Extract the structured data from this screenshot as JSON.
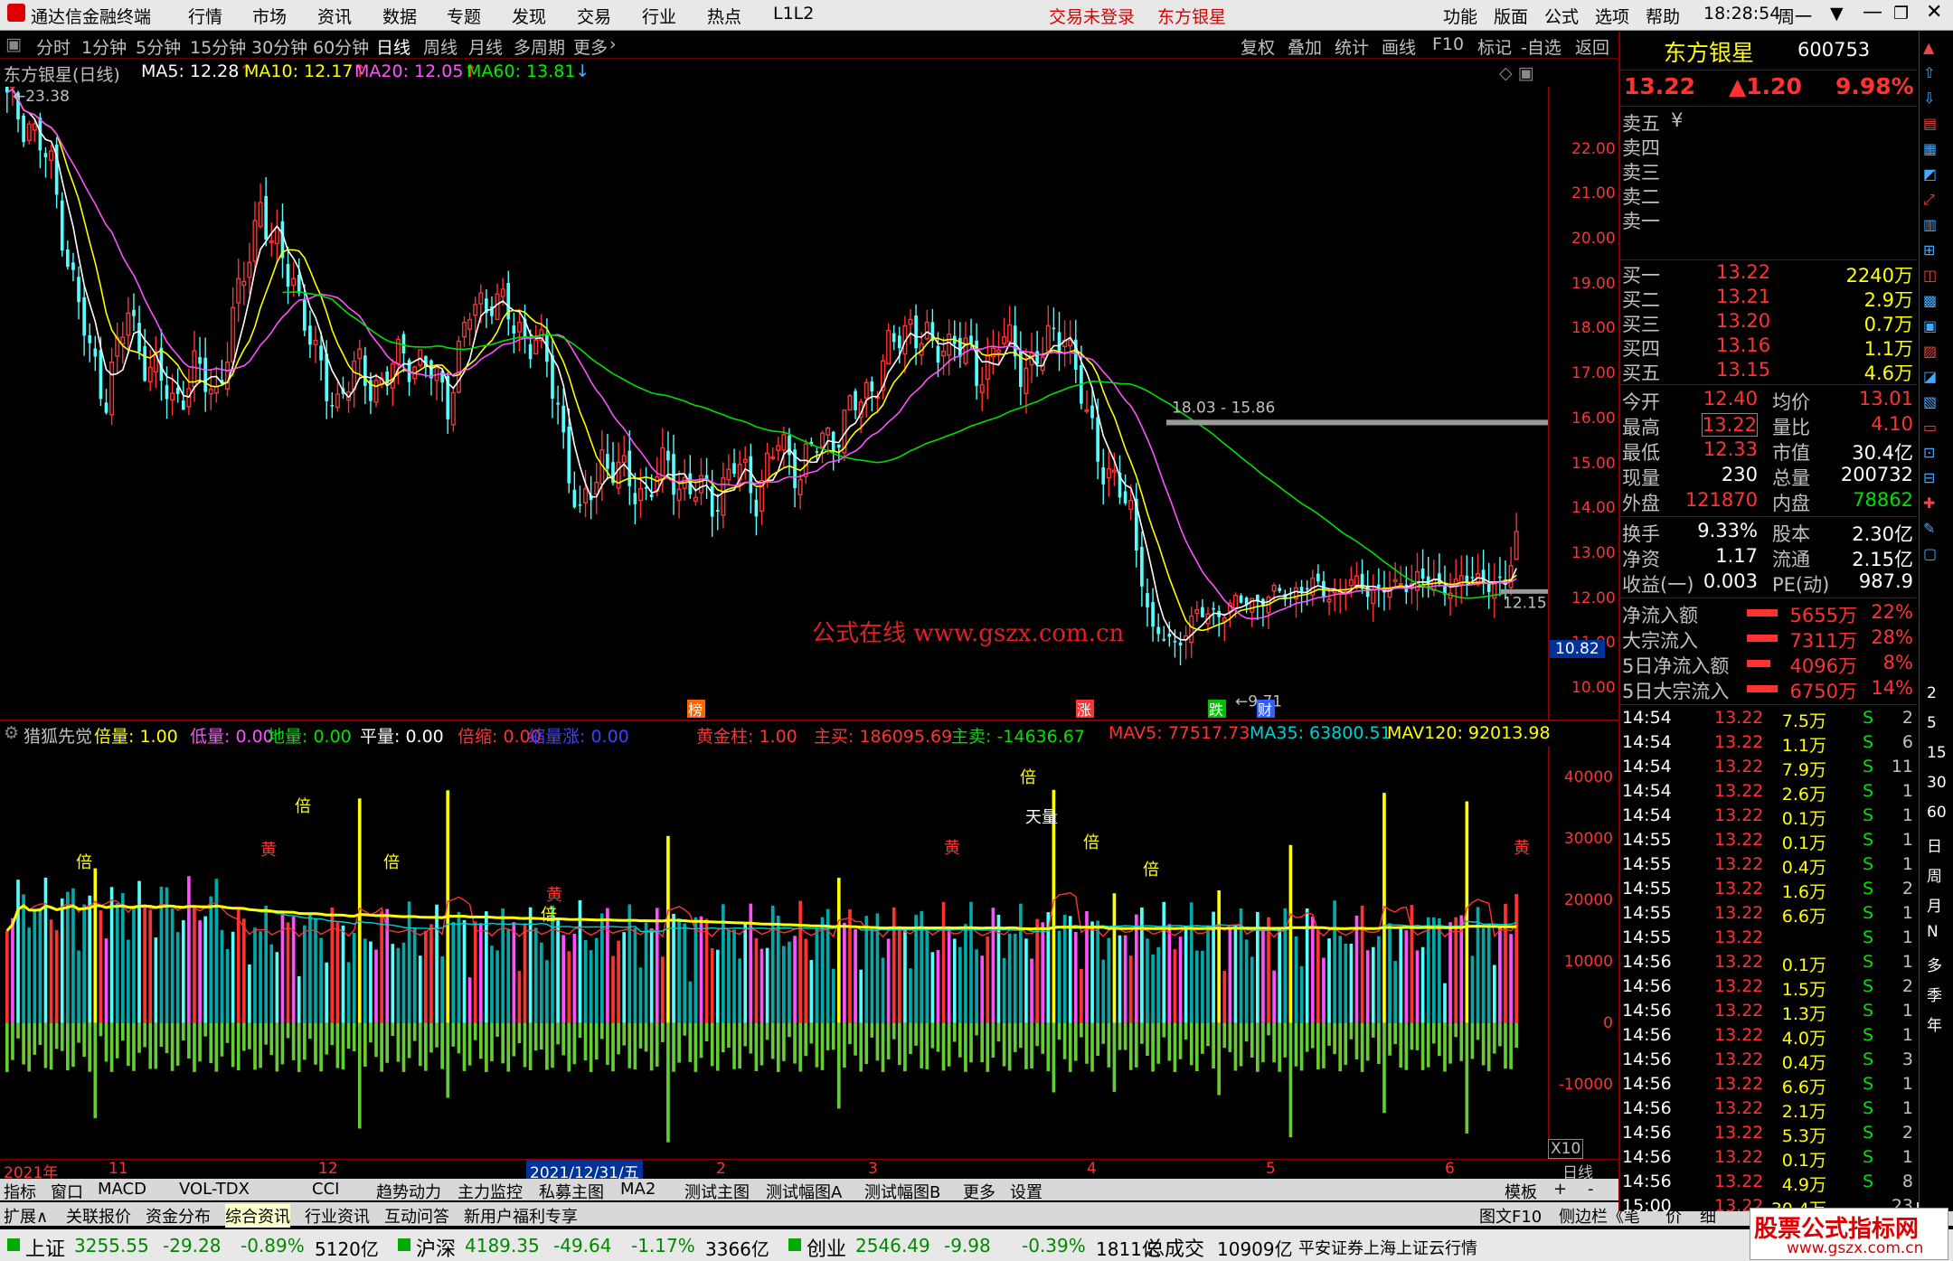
{
  "topbar": {
    "app_title": "通达信金融终端",
    "menu": [
      "行情",
      "市场",
      "资讯",
      "数据",
      "专题",
      "发现",
      "交易",
      "行业",
      "热点",
      "L1L2"
    ],
    "trade_status": "交易未登录",
    "stock_title": "东方银星",
    "right_menu": [
      "功能",
      "版面",
      "公式",
      "选项",
      "帮助"
    ],
    "time": "18:28:54",
    "weekday": "周一"
  },
  "periods": [
    "分时",
    "1分钟",
    "5分钟",
    "15分钟",
    "30分钟",
    "60分钟",
    "日线",
    "周线",
    "月线",
    "多周期",
    "更多"
  ],
  "toolbar": [
    "复权",
    "叠加",
    "统计",
    "画线",
    "F10",
    "标记",
    "-自选",
    "返回"
  ],
  "chart": {
    "title": "东方银星(日线)",
    "ma": [
      {
        "label": "MA5: 12.28",
        "color": "#ffffff"
      },
      {
        "label": "MA10: 12.17",
        "color": "#ffff00"
      },
      {
        "label": "MA20: 12.05",
        "color": "#ff50ff"
      },
      {
        "label": "MA60: 13.81",
        "color": "#00e000"
      }
    ],
    "high_label": "23.38",
    "low_label": "9.71",
    "line_label": "18.03 - 15.86",
    "last_label": "12.15",
    "cursor_price": "10.82",
    "watermark": "公式在线 www.gszx.com.cn",
    "markers": [
      "榜",
      "涨",
      "跌",
      "财"
    ],
    "y_ticks": [
      "22.00",
      "21.00",
      "20.00",
      "19.00",
      "18.00",
      "17.00",
      "16.00",
      "15.00",
      "14.00",
      "13.00",
      "12.00",
      "11.00",
      "10.00"
    ]
  },
  "indicator": {
    "name": "猎狐先觉",
    "fields": [
      {
        "t": "倍量: 1.00",
        "c": "#ffff00"
      },
      {
        "t": "低量: 0.00",
        "c": "#ff50ff"
      },
      {
        "t": "地量: 0.00",
        "c": "#00e000"
      },
      {
        "t": "平量: 0.00",
        "c": "#ffffff"
      },
      {
        "t": "倍缩: 0.00",
        "c": "#ff3232"
      },
      {
        "t": "缩量涨: 0.00",
        "c": "#4040ff"
      },
      {
        "t": "黄金柱: 1.00",
        "c": "#ff3232"
      },
      {
        "t": "主买: 186095.69",
        "c": "#ff3232"
      },
      {
        "t": "主卖: -14636.67",
        "c": "#00e000"
      },
      {
        "t": "MAV5: 77517.73",
        "c": "#ff3232"
      },
      {
        "t": "MA35: 63800.51",
        "c": "#00d0d0"
      },
      {
        "t": "MAV120: 92013.98",
        "c": "#ffff00"
      }
    ],
    "y_ticks": [
      "40000",
      "30000",
      "20000",
      "10000",
      "0",
      "-10000"
    ],
    "labels": [
      "倍",
      "黄",
      "天量"
    ],
    "x10": "X10"
  },
  "x_axis": [
    "2021年",
    "11",
    "12",
    "2021/12/31/五",
    "2",
    "3",
    "4",
    "5",
    "6",
    "日线"
  ],
  "quote": {
    "name": "东方银星",
    "code": "600753",
    "price": "13.22",
    "change": "▲1.20",
    "pct": "9.98%",
    "asks": [
      [
        "卖五",
        "",
        ""
      ],
      [
        "卖四",
        "",
        ""
      ],
      [
        "卖三",
        "",
        ""
      ],
      [
        "卖二",
        "",
        ""
      ],
      [
        "卖一",
        "",
        ""
      ]
    ],
    "bids": [
      [
        "买一",
        "13.22",
        "2240万"
      ],
      [
        "买二",
        "13.21",
        "2.9万"
      ],
      [
        "买三",
        "13.20",
        "0.7万"
      ],
      [
        "买四",
        "13.16",
        "1.1万"
      ],
      [
        "买五",
        "13.15",
        "4.6万"
      ]
    ],
    "stats": [
      [
        "今开",
        "12.40",
        "均价",
        "13.01"
      ],
      [
        "最高",
        "13.22",
        "量比",
        "4.10"
      ],
      [
        "最低",
        "12.33",
        "市值",
        "30.4亿"
      ],
      [
        "现量",
        "230",
        "总量",
        "200732"
      ],
      [
        "外盘",
        "121870",
        "内盘",
        "78862"
      ],
      [
        "换手",
        "9.33%",
        "股本",
        "2.30亿"
      ],
      [
        "净资",
        "1.17",
        "流通",
        "2.15亿"
      ],
      [
        "收益(一)",
        "0.003",
        "PE(动)",
        "987.9"
      ]
    ],
    "flows": [
      [
        "净流入额",
        "5655万",
        "22%"
      ],
      [
        "大宗流入",
        "7311万",
        "28%"
      ],
      [
        "5日净流入额",
        "4096万",
        "8%"
      ],
      [
        "5日大宗流入",
        "6750万",
        "14%"
      ]
    ],
    "ticks": [
      [
        "14:54",
        "13.22",
        "7.5万",
        "S",
        "2"
      ],
      [
        "14:54",
        "13.22",
        "1.1万",
        "S",
        "6"
      ],
      [
        "14:54",
        "13.22",
        "7.9万",
        "S",
        "11"
      ],
      [
        "14:54",
        "13.22",
        "2.6万",
        "S",
        "1"
      ],
      [
        "14:54",
        "13.22",
        "0.1万",
        "S",
        "1"
      ],
      [
        "14:55",
        "13.22",
        "0.1万",
        "S",
        "1"
      ],
      [
        "14:55",
        "13.22",
        "0.4万",
        "S",
        "1"
      ],
      [
        "14:55",
        "13.22",
        "1.6万",
        "S",
        "2"
      ],
      [
        "14:55",
        "13.22",
        "6.6万",
        "S",
        "1"
      ],
      [
        "14:55",
        "13.22",
        "",
        "S",
        "1"
      ],
      [
        "14:56",
        "13.22",
        "0.1万",
        "S",
        "1"
      ],
      [
        "14:56",
        "13.22",
        "1.5万",
        "S",
        "2"
      ],
      [
        "14:56",
        "13.22",
        "1.3万",
        "S",
        "1"
      ],
      [
        "14:56",
        "13.22",
        "4.0万",
        "S",
        "1"
      ],
      [
        "14:56",
        "13.22",
        "0.4万",
        "S",
        "3"
      ],
      [
        "14:56",
        "13.22",
        "6.6万",
        "S",
        "1"
      ],
      [
        "14:56",
        "13.22",
        "2.1万",
        "S",
        "1"
      ],
      [
        "14:56",
        "13.22",
        "5.3万",
        "S",
        "2"
      ],
      [
        "14:56",
        "13.22",
        "0.1万",
        "S",
        "1"
      ],
      [
        "14:56",
        "13.22",
        "4.9万",
        "S",
        "8"
      ],
      [
        "15:00",
        "13.22",
        "30.4万",
        "",
        "23"
      ]
    ]
  },
  "sidebar": [
    "2",
    "5",
    "15",
    "30",
    "60",
    "日",
    "周",
    "月",
    "N",
    "多",
    "季",
    "年"
  ],
  "bottom_tabs": [
    "指标",
    "窗口",
    "MACD",
    "VOL-TDX",
    "CCI",
    "趋势动力",
    "主力监控",
    "私募主图",
    "MA2",
    "测试主图",
    "测试幅图A",
    "测试幅图B",
    "更多",
    "设置"
  ],
  "bottom_right": [
    "模板",
    "+",
    "-"
  ],
  "bottom_tabs2": [
    "扩展∧",
    "关联报价",
    "资金分布",
    "综合资讯",
    "行业资讯",
    "互动问答",
    "新用户福利专享"
  ],
  "bottom_tabs2_right": [
    "图文F10",
    "侧边栏《",
    "笔",
    "价",
    "细"
  ],
  "status": [
    {
      "n": "上证",
      "v": "3255.55",
      "c": "-29.28",
      "p": "-0.89%",
      "a": "5120亿"
    },
    {
      "n": "沪深",
      "v": "4189.35",
      "c": "-49.64",
      "p": "-1.17%",
      "a": "3366亿"
    },
    {
      "n": "创业",
      "v": "2546.49",
      "c": "-9.98",
      "p": "-0.39%",
      "a": "1811亿"
    }
  ],
  "status_total_label": "总成交",
  "status_total": "10909亿",
  "status_broker": "平安证券上海上证云行情",
  "site_badge": {
    "line1": "股票公式指标网",
    "line2": "www.gszx.com.cn"
  }
}
